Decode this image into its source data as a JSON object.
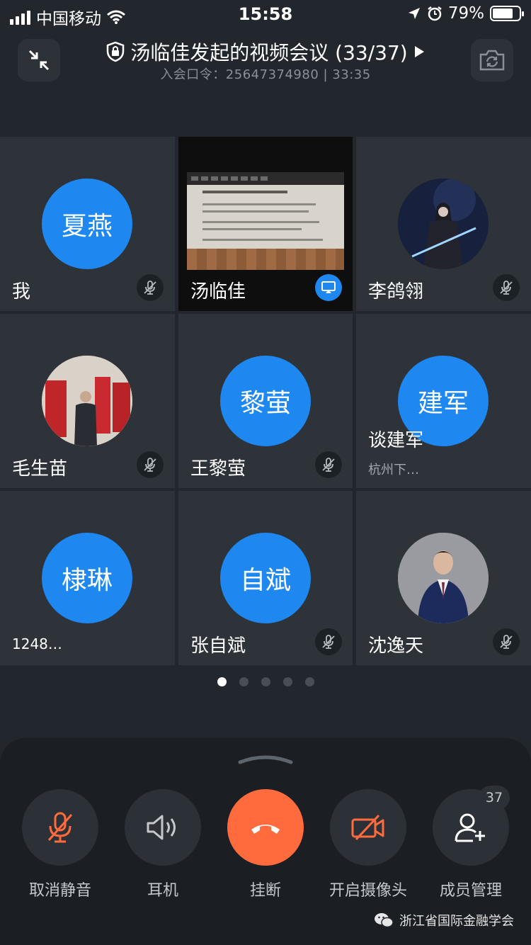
{
  "status_bar": {
    "carrier": "中国移动",
    "time": "15:58",
    "battery": "79%",
    "battery_level": 0.79,
    "icons": [
      "signal-icon",
      "wifi-icon",
      "location-icon",
      "alarm-icon",
      "battery-icon"
    ]
  },
  "header": {
    "title": "汤临佳发起的视频会议 (33/37)",
    "subtitle": "入会口令：25647374980 | 33:35",
    "left_button_icon": "collapse-icon",
    "right_button_icon": "switch-camera-icon",
    "title_icon": "shield-lock-icon",
    "title_arrow_icon": "play-arrow-icon"
  },
  "participants": [
    {
      "name": "我",
      "avatar_text": "夏燕",
      "avatar_type": "text",
      "status_icon": "mic-off-icon"
    },
    {
      "name": "汤临佳",
      "avatar_type": "screen-share",
      "status_icon": "screen-share-icon"
    },
    {
      "name": "李鸽翎",
      "avatar_type": "photo",
      "status_icon": "mic-off-icon"
    },
    {
      "name": "毛生苗",
      "avatar_type": "photo",
      "status_icon": "mic-off-icon"
    },
    {
      "name": "王黎萤",
      "avatar_text": "黎萤",
      "avatar_type": "text",
      "status_icon": "mic-off-icon"
    },
    {
      "name": "谈建军",
      "avatar_text": "建军",
      "avatar_type": "text",
      "subtitle": "杭州下…"
    },
    {
      "name": "1248…",
      "avatar_text": "棣琳",
      "avatar_type": "text"
    },
    {
      "name": "张自斌",
      "avatar_text": "自斌",
      "avatar_type": "text",
      "status_icon": "mic-off-icon"
    },
    {
      "name": "沈逸天",
      "avatar_type": "photo",
      "status_icon": "mic-off-icon"
    }
  ],
  "pager": {
    "total": 5,
    "current": 1
  },
  "controls": [
    {
      "label": "取消静音",
      "icon": "mic-off-icon"
    },
    {
      "label": "耳机",
      "icon": "speaker-icon"
    },
    {
      "label": "挂断",
      "icon": "hangup-icon"
    },
    {
      "label": "开启摄像头",
      "icon": "camera-off-icon"
    },
    {
      "label": "成员管理",
      "icon": "add-member-icon"
    }
  ],
  "member_count": "37",
  "watermark": "浙江省国际金融学会",
  "colors": {
    "accent": "#1e88f0",
    "hangup": "#ff6b3d",
    "alert": "#ff6b3d"
  }
}
